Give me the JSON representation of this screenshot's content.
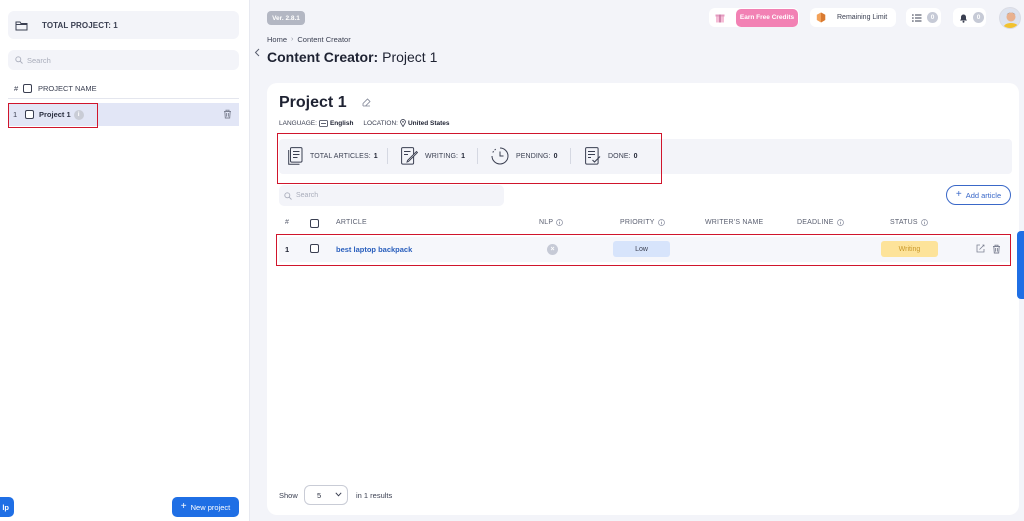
{
  "sidebar": {
    "total_label": "TOTAL PROJECT: 1",
    "search_placeholder": "Search",
    "table_header": {
      "hash": "#",
      "name": "PROJECT NAME"
    },
    "projects": [
      {
        "num": "1",
        "name": "Project 1"
      }
    ],
    "help_label": "lp",
    "new_project_label": "New project"
  },
  "header": {
    "version": "Ver. 2.8.1",
    "breadcrumb": {
      "home": "Home",
      "current": "Content Creator"
    },
    "title_prefix": "Content Creator:",
    "title_project": "Project 1",
    "earn_credits_label": "Earn Free Credits",
    "remaining_limit_label": "Remaining Limit",
    "tasks_count": "0",
    "notifications_count": "0"
  },
  "project": {
    "title": "Project 1",
    "language_label": "LANGUAGE:",
    "language_value": "English",
    "location_label": "LOCATION:",
    "location_value": "United States",
    "stats": [
      {
        "label": "TOTAL ARTICLES:",
        "value": "1"
      },
      {
        "label": "WRITING:",
        "value": "1"
      },
      {
        "label": "PENDING:",
        "value": "0"
      },
      {
        "label": "DONE:",
        "value": "0"
      }
    ],
    "search_placeholder": "Search",
    "add_article_label": "Add article",
    "columns": {
      "num": "#",
      "article": "ARTICLE",
      "nlp": "NLP",
      "priority": "PRIORITY",
      "writer": "WRITER'S NAME",
      "deadline": "DEADLINE",
      "status": "STATUS"
    },
    "rows": [
      {
        "num": "1",
        "article": "best laptop backpack",
        "priority": "Low",
        "status": "Writing"
      }
    ],
    "footer": {
      "show_label": "Show",
      "page_size": "5",
      "results_label": "in 1 results"
    }
  },
  "colors": {
    "accent": "#1f6fe5",
    "highlight_box": "#d0152c",
    "priority_bg": "#d7e4fb",
    "status_bg": "#fde39a",
    "earn_btn": "#f281b4"
  },
  "icons": [
    "folder-icon",
    "search-icon",
    "trash-icon",
    "info-icon",
    "plus-icon",
    "gift-icon",
    "shield-icon",
    "list-icon",
    "bell-icon",
    "edit-icon",
    "document-icon",
    "pencil-doc-icon",
    "clock-icon",
    "done-doc-icon",
    "location-icon",
    "language-icon",
    "chevron-down-icon",
    "chevron-left-icon",
    "close-icon"
  ]
}
